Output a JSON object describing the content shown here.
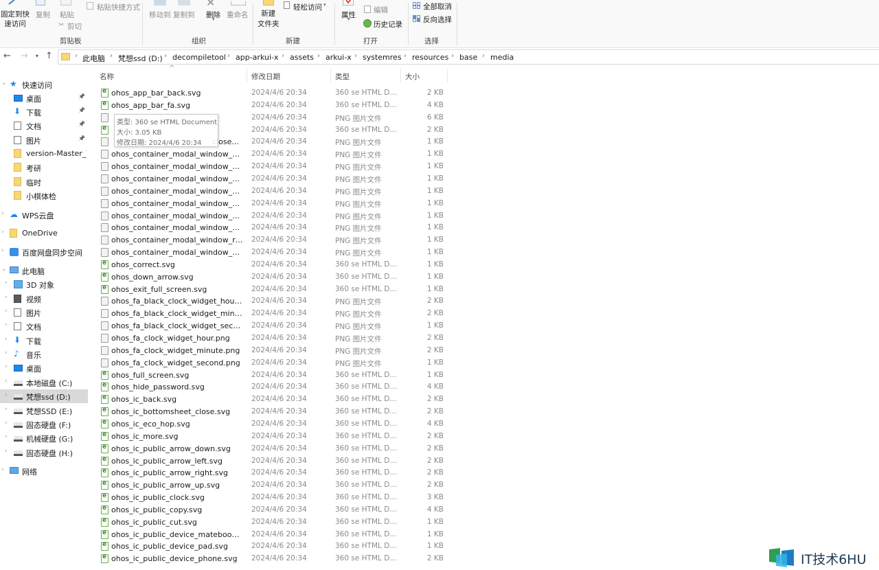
{
  "ribbon": {
    "pin_quick_access": "固定到快\n速访问",
    "copy": "复制",
    "paste": "粘贴",
    "paste_shortcut": "粘贴快捷方式",
    "cut": "剪切",
    "clipboard_group": "剪贴板",
    "move_to": "移动到",
    "copy_to": "复制到",
    "delete": "删除",
    "rename": "重命名",
    "organize_group": "组织",
    "new_folder": "新建\n文件夹",
    "easy_access": "轻松访问",
    "new_group": "新建",
    "properties": "属性",
    "edit": "编辑",
    "history": "历史记录",
    "open_group": "打开",
    "select_none": "全部取消",
    "invert_selection": "反向选择",
    "select_group": "选择"
  },
  "address": {
    "crumbs": [
      "此电脑",
      "梵想ssd (D:)",
      "decompiletool",
      "app-arkui-x",
      "assets",
      "arkui-x",
      "systemres",
      "resources",
      "base",
      "media"
    ]
  },
  "sidebar": {
    "items": [
      {
        "label": "快速访问",
        "icon": "star-icon",
        "chevron": "open"
      },
      {
        "label": "桌面",
        "icon": "desktop-icon",
        "pin": true
      },
      {
        "label": "下载",
        "icon": "download-icon",
        "pin": true
      },
      {
        "label": "文档",
        "icon": "document-icon",
        "pin": true
      },
      {
        "label": "图片",
        "icon": "picture-icon",
        "pin": true
      },
      {
        "label": "version-Master_V(",
        "icon": "folder-icon"
      },
      {
        "label": "考研",
        "icon": "folder-icon"
      },
      {
        "label": "临时",
        "icon": "folder-icon"
      },
      {
        "label": "小棋体检",
        "icon": "folder-icon"
      },
      {
        "label": "WPS云盘",
        "icon": "cloud-icon",
        "chevron": "closed"
      },
      {
        "label": "OneDrive",
        "icon": "folder-icon",
        "chevron": "closed"
      },
      {
        "label": "百度网盘同步空间",
        "icon": "baidu-icon",
        "chevron": "closed"
      },
      {
        "label": "此电脑",
        "icon": "computer-icon",
        "chevron": "open"
      },
      {
        "label": "3D 对象",
        "icon": "3d-objects-icon",
        "chevron": "closed"
      },
      {
        "label": "视频",
        "icon": "video-icon",
        "chevron": "closed"
      },
      {
        "label": "图片",
        "icon": "picture-icon",
        "chevron": "closed"
      },
      {
        "label": "文档",
        "icon": "document-icon",
        "chevron": "closed"
      },
      {
        "label": "下载",
        "icon": "download-icon",
        "chevron": "closed"
      },
      {
        "label": "音乐",
        "icon": "music-icon",
        "chevron": "closed"
      },
      {
        "label": "桌面",
        "icon": "desktop-icon",
        "chevron": "closed"
      },
      {
        "label": "本地磁盘 (C:)",
        "icon": "drive-icon",
        "chevron": "closed"
      },
      {
        "label": "梵想ssd (D:)",
        "icon": "drive-icon",
        "chevron": "closed",
        "selected": true
      },
      {
        "label": "梵想SSD (E:)",
        "icon": "drive-icon",
        "chevron": "closed"
      },
      {
        "label": "固态硬盘 (F:)",
        "icon": "drive-icon",
        "chevron": "closed"
      },
      {
        "label": "机械硬盘 (G:)",
        "icon": "drive-icon",
        "chevron": "closed"
      },
      {
        "label": "固态硬盘 (H:)",
        "icon": "drive-icon",
        "chevron": "closed"
      },
      {
        "label": "网络",
        "icon": "network-icon",
        "chevron": "closed"
      }
    ]
  },
  "columns": {
    "name": "名称",
    "date": "修改日期",
    "type": "类型",
    "size": "大小"
  },
  "files": [
    {
      "name": "ohos_app_bar_back.svg",
      "date": "2024/4/6 20:34",
      "type": "360 se HTML Do...",
      "size": "2 KB",
      "kind": "svg"
    },
    {
      "name": "ohos_app_bar_fa.svg",
      "date": "2024/4/6 20:34",
      "type": "360 se HTML Do...",
      "size": "4 KB",
      "kind": "svg"
    },
    {
      "name": "",
      "date": "2024/4/6 20:34",
      "type": "PNG 图片文件",
      "size": "6 KB",
      "kind": "png"
    },
    {
      "name": "",
      "date": "2024/4/6 20:34",
      "type": "360 se HTML Do...",
      "size": "2 KB",
      "kind": "svg"
    },
    {
      "name": "close...",
      "date": "2024/4/6 20:34",
      "type": "PNG 图片文件",
      "size": "1 KB",
      "kind": "png"
    },
    {
      "name": "ohos_container_modal_window_defoc...",
      "date": "2024/4/6 20:34",
      "type": "PNG 图片文件",
      "size": "1 KB",
      "kind": "png"
    },
    {
      "name": "ohos_container_modal_window_defoc...",
      "date": "2024/4/6 20:34",
      "type": "PNG 图片文件",
      "size": "1 KB",
      "kind": "png"
    },
    {
      "name": "ohos_container_modal_window_defoc...",
      "date": "2024/4/6 20:34",
      "type": "PNG 图片文件",
      "size": "1 KB",
      "kind": "png"
    },
    {
      "name": "ohos_container_modal_window_defoc...",
      "date": "2024/4/6 20:34",
      "type": "PNG 图片文件",
      "size": "1 KB",
      "kind": "png"
    },
    {
      "name": "ohos_container_modal_window_defoc...",
      "date": "2024/4/6 20:34",
      "type": "PNG 图片文件",
      "size": "1 KB",
      "kind": "png"
    },
    {
      "name": "ohos_container_modal_window_maxi...",
      "date": "2024/4/6 20:34",
      "type": "PNG 图片文件",
      "size": "1 KB",
      "kind": "png"
    },
    {
      "name": "ohos_container_modal_window_mini...",
      "date": "2024/4/6 20:34",
      "type": "PNG 图片文件",
      "size": "1 KB",
      "kind": "png"
    },
    {
      "name": "ohos_container_modal_window_recov...",
      "date": "2024/4/6 20:34",
      "type": "PNG 图片文件",
      "size": "1 KB",
      "kind": "png"
    },
    {
      "name": "ohos_container_modal_window_split_l...",
      "date": "2024/4/6 20:34",
      "type": "PNG 图片文件",
      "size": "1 KB",
      "kind": "png"
    },
    {
      "name": "ohos_correct.svg",
      "date": "2024/4/6 20:34",
      "type": "360 se HTML Do...",
      "size": "1 KB",
      "kind": "svg"
    },
    {
      "name": "ohos_down_arrow.svg",
      "date": "2024/4/6 20:34",
      "type": "360 se HTML Do...",
      "size": "1 KB",
      "kind": "svg"
    },
    {
      "name": "ohos_exit_full_screen.svg",
      "date": "2024/4/6 20:34",
      "type": "360 se HTML Do...",
      "size": "1 KB",
      "kind": "svg"
    },
    {
      "name": "ohos_fa_black_clock_widget_hour.png",
      "date": "2024/4/6 20:34",
      "type": "PNG 图片文件",
      "size": "2 KB",
      "kind": "png"
    },
    {
      "name": "ohos_fa_black_clock_widget_minute.p...",
      "date": "2024/4/6 20:34",
      "type": "PNG 图片文件",
      "size": "2 KB",
      "kind": "png"
    },
    {
      "name": "ohos_fa_black_clock_widget_second....",
      "date": "2024/4/6 20:34",
      "type": "PNG 图片文件",
      "size": "1 KB",
      "kind": "png"
    },
    {
      "name": "ohos_fa_clock_widget_hour.png",
      "date": "2024/4/6 20:34",
      "type": "PNG 图片文件",
      "size": "2 KB",
      "kind": "png"
    },
    {
      "name": "ohos_fa_clock_widget_minute.png",
      "date": "2024/4/6 20:34",
      "type": "PNG 图片文件",
      "size": "2 KB",
      "kind": "png"
    },
    {
      "name": "ohos_fa_clock_widget_second.png",
      "date": "2024/4/6 20:34",
      "type": "PNG 图片文件",
      "size": "1 KB",
      "kind": "png"
    },
    {
      "name": "ohos_full_screen.svg",
      "date": "2024/4/6 20:34",
      "type": "360 se HTML Do...",
      "size": "1 KB",
      "kind": "svg"
    },
    {
      "name": "ohos_hide_password.svg",
      "date": "2024/4/6 20:34",
      "type": "360 se HTML Do...",
      "size": "4 KB",
      "kind": "svg"
    },
    {
      "name": "ohos_ic_back.svg",
      "date": "2024/4/6 20:34",
      "type": "360 se HTML Do...",
      "size": "2 KB",
      "kind": "svg"
    },
    {
      "name": "ohos_ic_bottomsheet_close.svg",
      "date": "2024/4/6 20:34",
      "type": "360 se HTML Do...",
      "size": "2 KB",
      "kind": "svg"
    },
    {
      "name": "ohos_ic_eco_hop.svg",
      "date": "2024/4/6 20:34",
      "type": "360 se HTML Do...",
      "size": "4 KB",
      "kind": "svg"
    },
    {
      "name": "ohos_ic_more.svg",
      "date": "2024/4/6 20:34",
      "type": "360 se HTML Do...",
      "size": "2 KB",
      "kind": "svg"
    },
    {
      "name": "ohos_ic_public_arrow_down.svg",
      "date": "2024/4/6 20:34",
      "type": "360 se HTML Do...",
      "size": "2 KB",
      "kind": "svg"
    },
    {
      "name": "ohos_ic_public_arrow_left.svg",
      "date": "2024/4/6 20:34",
      "type": "360 se HTML Do...",
      "size": "2 KB",
      "kind": "svg"
    },
    {
      "name": "ohos_ic_public_arrow_right.svg",
      "date": "2024/4/6 20:34",
      "type": "360 se HTML Do...",
      "size": "2 KB",
      "kind": "svg"
    },
    {
      "name": "ohos_ic_public_arrow_up.svg",
      "date": "2024/4/6 20:34",
      "type": "360 se HTML Do...",
      "size": "2 KB",
      "kind": "svg"
    },
    {
      "name": "ohos_ic_public_clock.svg",
      "date": "2024/4/6 20:34",
      "type": "360 se HTML Do...",
      "size": "3 KB",
      "kind": "svg"
    },
    {
      "name": "ohos_ic_public_copy.svg",
      "date": "2024/4/6 20:34",
      "type": "360 se HTML Do...",
      "size": "4 KB",
      "kind": "svg"
    },
    {
      "name": "ohos_ic_public_cut.svg",
      "date": "2024/4/6 20:34",
      "type": "360 se HTML Do...",
      "size": "1 KB",
      "kind": "svg"
    },
    {
      "name": "ohos_ic_public_device_matebook.svg",
      "date": "2024/4/6 20:34",
      "type": "360 se HTML Do...",
      "size": "1 KB",
      "kind": "svg"
    },
    {
      "name": "ohos_ic_public_device_pad.svg",
      "date": "2024/4/6 20:34",
      "type": "360 se HTML Do...",
      "size": "1 KB",
      "kind": "svg"
    },
    {
      "name": "ohos_ic_public_device_phone.svg",
      "date": "2024/4/6 20:34",
      "type": "360 se HTML Do...",
      "size": "2 KB",
      "kind": "svg"
    }
  ],
  "tooltip": {
    "type_line": "类型: 360 se HTML Document",
    "size_line": "大小: 3.05 KB",
    "date_line": "修改日期: 2024/4/6 20:34"
  },
  "watermark": {
    "text": "IT技术6HU"
  },
  "colors": {
    "accent": "#1e88e5",
    "folder": "#f8d775",
    "selected_bg": "#d9d9d9"
  }
}
